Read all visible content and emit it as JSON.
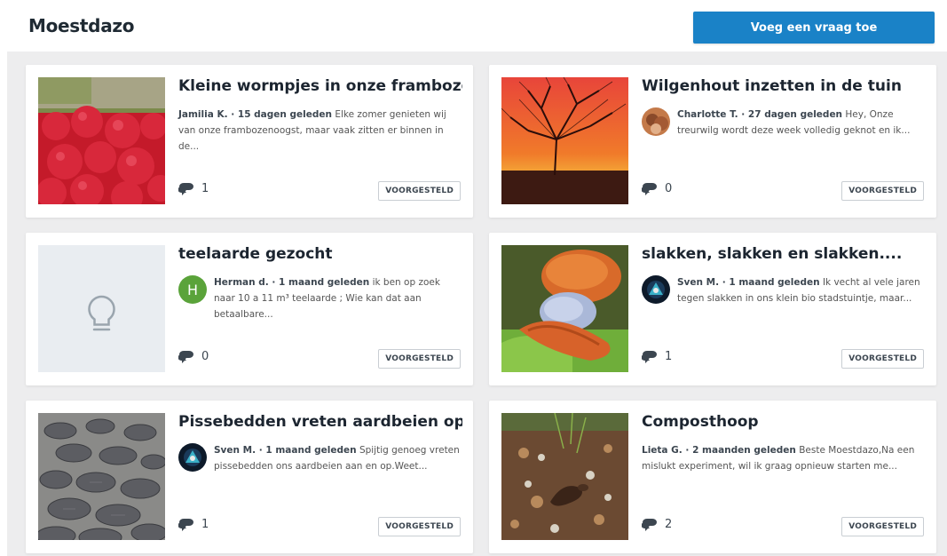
{
  "header": {
    "title": "Moestdazo",
    "add_question_label": "Voeg een vraag toe"
  },
  "colors": {
    "accent": "#1a82c7",
    "board_bg": "#ededee",
    "avatar_green": "#5aa33a"
  },
  "cards": [
    {
      "title": "Kleine wormpjes in onze frambozen",
      "author": "Jamilia K. · 15 dagen geleden",
      "excerpt": "Elke zomer genieten wij van onze frambozenoogst, maar vaak zitten er binnen in de...",
      "comments": "1",
      "badge": "VOORGESTELD",
      "image": "raspberries-photo",
      "avatar": null
    },
    {
      "title": "Wilgenhout inzetten in de tuin",
      "author": "Charlotte T. · 27 dagen geleden",
      "excerpt": "Hey, Onze treurwilg wordt deze week volledig geknot en ik...",
      "comments": "0",
      "badge": "VOORGESTELD",
      "image": "willow-sunset-photo",
      "avatar": "photo-avatar"
    },
    {
      "title": "teelaarde gezocht",
      "author": "Herman d. · 1 maand geleden",
      "excerpt": "ik ben op zoek naar 10 a 11 m³ teelaarde ; Wie kan dat aan betaalbare...",
      "comments": "0",
      "badge": "VOORGESTELD",
      "image": "lightbulb-icon",
      "avatar": "H"
    },
    {
      "title": "slakken, slakken en slakken....",
      "author": "Sven M. · 1 maand geleden",
      "excerpt": "Ik vecht al vele jaren tegen slakken in ons klein bio stadstuintje, maar...",
      "comments": "1",
      "badge": "VOORGESTELD",
      "image": "slugs-photo",
      "avatar": "photo-avatar"
    },
    {
      "title": "Pissebedden vreten aardbeien op",
      "author": "Sven M. · 1 maand geleden",
      "excerpt": "Spijtig genoeg vreten pissebedden ons aardbeien aan en op.Weet...",
      "comments": "1",
      "badge": "VOORGESTELD",
      "image": "woodlice-photo",
      "avatar": "photo-avatar"
    },
    {
      "title": "Composthoop",
      "author": "Lieta G. · 2 maanden geleden",
      "excerpt": "Beste Moestdazo,Na een mislukt experiment, wil ik graag opnieuw starten me...",
      "comments": "2",
      "badge": "VOORGESTELD",
      "image": "compost-photo",
      "avatar": null
    }
  ]
}
